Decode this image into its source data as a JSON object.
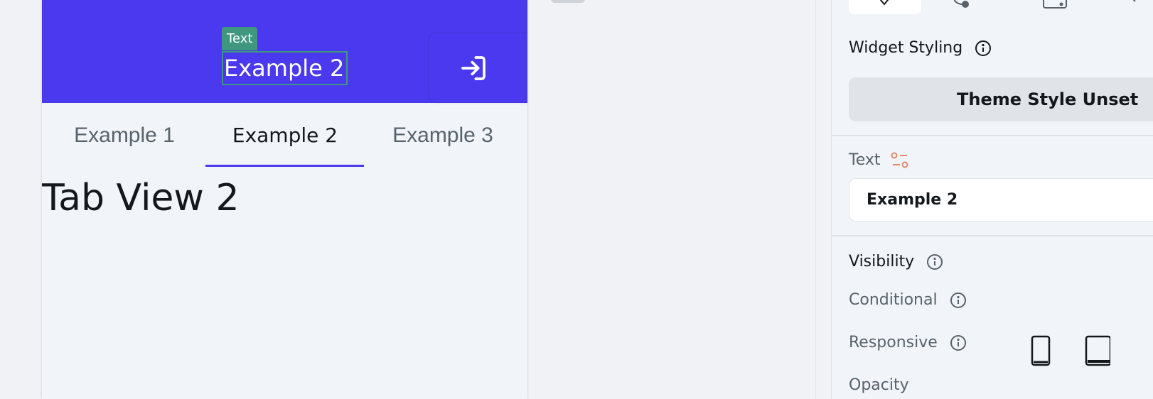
{
  "canvas": {
    "selection_tag": "Text",
    "appbar_title": "Example 2",
    "appbar_action_icon": "login-icon",
    "tabs": [
      {
        "label": "Example 1"
      },
      {
        "label": "Example 2",
        "active": true
      },
      {
        "label": "Example 3"
      }
    ],
    "tab_content_title": "Tab View 2",
    "colors": {
      "primary": "#4b39ef",
      "selection": "#40977f"
    }
  },
  "panel": {
    "widget_styling_label": "Widget Styling",
    "theme_style_button": "Theme Style Unset",
    "text_label": "Text",
    "text_value": "Example 2",
    "visibility_label": "Visibility",
    "conditional_label": "Conditional",
    "responsive_label": "Responsive",
    "cut_label": "Opacity"
  }
}
